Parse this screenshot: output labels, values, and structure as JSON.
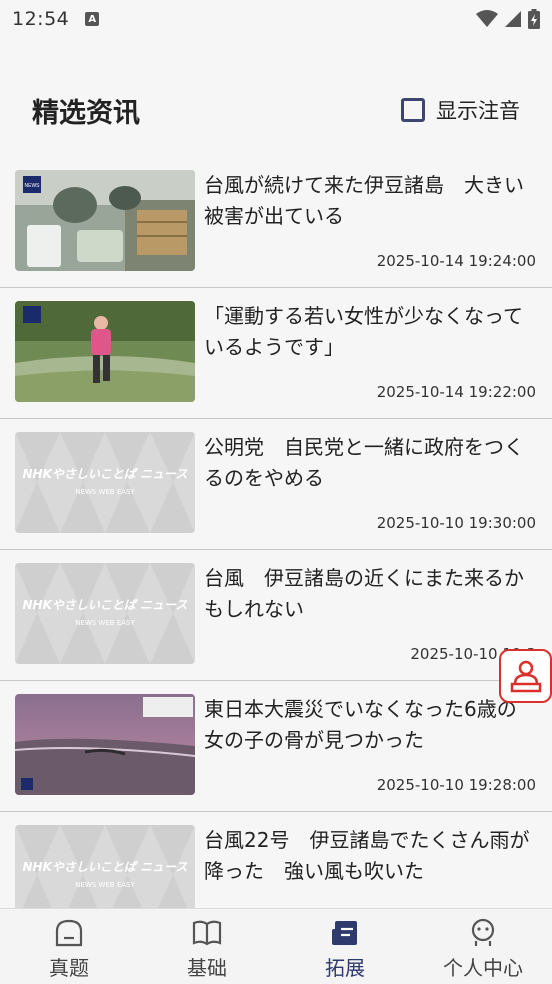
{
  "status_bar": {
    "time": "12:54"
  },
  "header": {
    "title": "精选资讯",
    "toggle_label": "显示注音"
  },
  "news": [
    {
      "title": "台風が続けて来た伊豆諸島　大きい被害が出ている",
      "date": "2025-10-14 19:24:00",
      "thumb": "photo-cleanup"
    },
    {
      "title": "「運動する若い女性が少なくなっているようです」",
      "date": "2025-10-14 19:22:00",
      "thumb": "photo-runner"
    },
    {
      "title": "公明党　自民党と一緒に政府をつくるのをやめる",
      "date": "2025-10-10 19:30:00",
      "thumb": "nhk-placeholder"
    },
    {
      "title": "台風　伊豆諸島の近くにまた来るかもしれない",
      "date": "2025-10-10 19:3",
      "thumb": "nhk-placeholder"
    },
    {
      "title": "東日本大震災でいなくなった6歳の女の子の骨が見つかった",
      "date": "2025-10-10 19:28:00",
      "thumb": "photo-beach"
    },
    {
      "title": "台風22号　伊豆諸島でたくさん雨が降った　強い風も吹いた",
      "date": "",
      "thumb": "nhk-placeholder"
    }
  ],
  "nhk_placeholder": {
    "logo": "NHKやさしいことば ニュース",
    "sub": "NEWS WEB EASY"
  },
  "nav": [
    {
      "label": "真题",
      "icon": "home-icon"
    },
    {
      "label": "基础",
      "icon": "book-icon"
    },
    {
      "label": "拓展",
      "icon": "newspaper-icon"
    },
    {
      "label": "个人中心",
      "icon": "profile-icon"
    }
  ],
  "active_tab": 2,
  "colors": {
    "accent": "#2e3a6e",
    "float_button": "#d9302b"
  }
}
